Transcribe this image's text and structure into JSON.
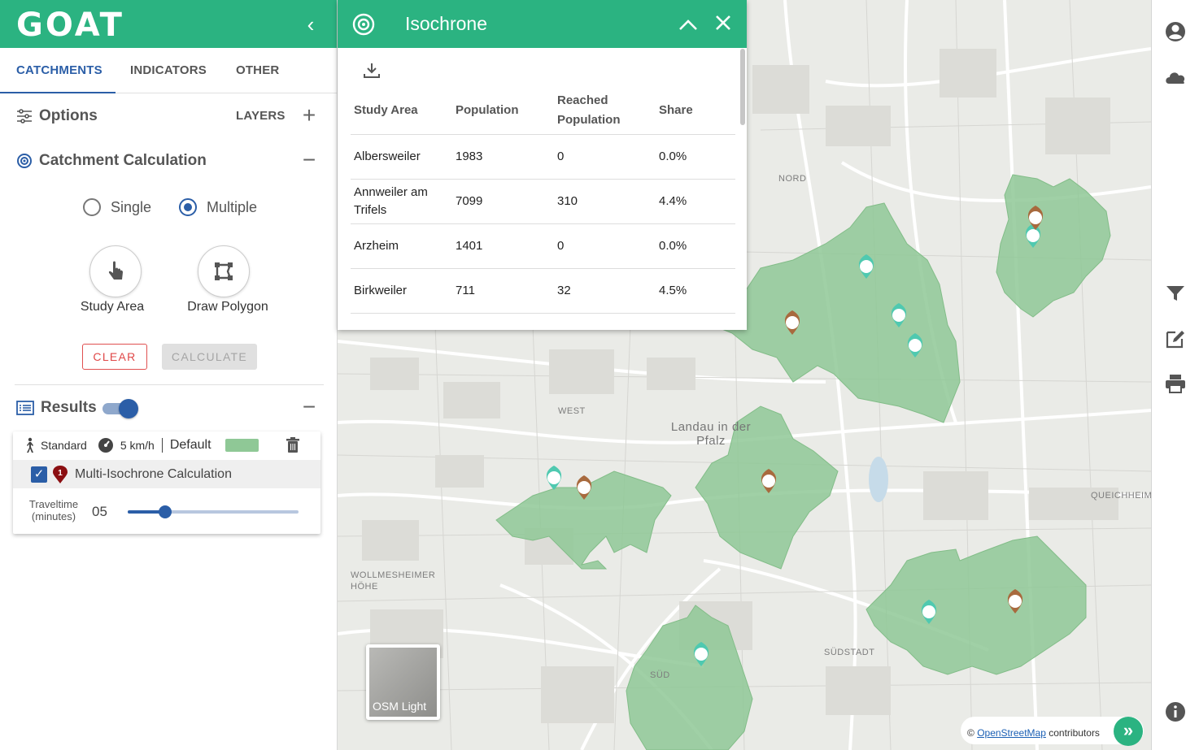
{
  "brand": {
    "logo": "GOAT"
  },
  "tabs": [
    "CATCHMENTS",
    "INDICATORS",
    "OTHER LAYERS"
  ],
  "sections": {
    "options": "Options",
    "catchment": "Catchment Calculation",
    "results": "Results"
  },
  "calc": {
    "mode_single": "Single",
    "mode_multiple": "Multiple",
    "selected_mode": "Multiple",
    "study_area": "Study Area",
    "draw_polygon": "Draw Polygon",
    "clear": "CLEAR",
    "calculate": "CALCULATE"
  },
  "results": {
    "toggle_on": true,
    "mode": "Standard",
    "speed": "5 km/h",
    "routing": "Default",
    "color": "#8fc896",
    "marker_number": "1",
    "title": "Multi-Isochrone Calculation",
    "checked": true,
    "traveltime_label_1": "Traveltime",
    "traveltime_label_2": "(minutes)",
    "traveltime_value": "05",
    "traveltime_fraction": 0.22
  },
  "isochrone_popup": {
    "title": "Isochrone",
    "columns": [
      "Study Area",
      "Population",
      "Reached Population",
      "Share"
    ],
    "rows": [
      [
        "Albersweiler",
        "1983",
        "0",
        "0.0%"
      ],
      [
        "Annweiler am Trifels",
        "7099",
        "310",
        "4.4%"
      ],
      [
        "Arzheim",
        "1401",
        "0",
        "0.0%"
      ],
      [
        "Birkweiler",
        "711",
        "32",
        "4.5%"
      ]
    ]
  },
  "map": {
    "labels": {
      "nord": "NORD",
      "west": "WEST",
      "city": "Landau in der Pfalz",
      "queichheim": "QUEICHHEIM",
      "wollmesheimer": "WOLLMESHEIMER HÖHE",
      "suedstadt": "SÜDSTADT",
      "sued": "SÜD"
    },
    "basemap": "OSM Light",
    "attribution_link": "OpenStreetMap",
    "attribution_suffix": " contributors",
    "isochrone_fill": "#8fc896"
  },
  "colors": {
    "brand_green": "#2bb381",
    "primary_blue": "#2b5ea7",
    "clear_red": "#e04848",
    "poi_teal": "#4fc9b0",
    "poi_brown": "#a86a3e"
  },
  "icons": [
    "chevron-left-icon",
    "sliders-icon",
    "target-icon",
    "pointer-hand-icon",
    "polygon-icon",
    "list-icon",
    "walking-icon",
    "speedometer-icon",
    "trash-icon",
    "map-marker-icon",
    "download-icon",
    "chevron-up-icon",
    "close-icon",
    "user-icon",
    "cloud-icon",
    "filter-icon",
    "edit-icon",
    "print-icon",
    "info-icon",
    "double-chevron-icon",
    "shopping-cart-icon",
    "basket-icon"
  ]
}
